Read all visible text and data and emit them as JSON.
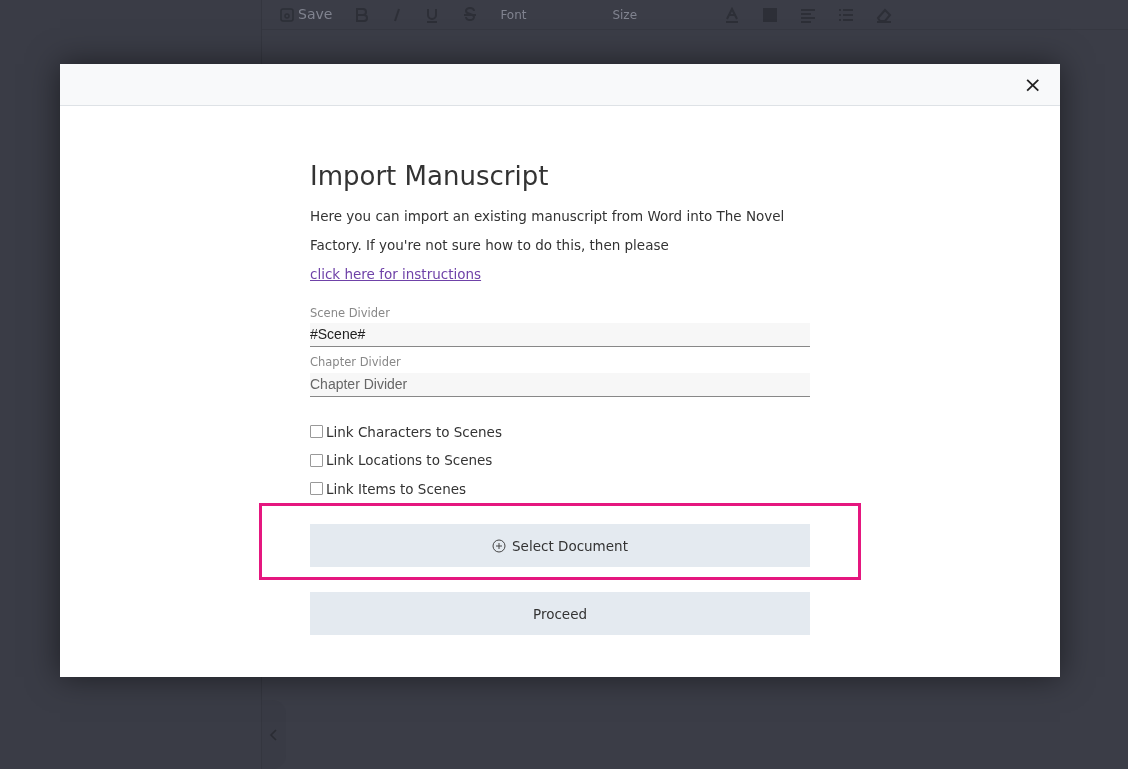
{
  "toolbar": {
    "save_label": "Save",
    "font_placeholder": "Font",
    "size_placeholder": "Size"
  },
  "dialog": {
    "close": "×",
    "title": "Import Manuscript",
    "intro": "Here you can import an existing manuscript from Word into The Novel Factory. If you're not sure how to do this, then please",
    "link": "click here for instructions",
    "fields": [
      {
        "label": "Scene Divider",
        "value": "#Scene#"
      },
      {
        "label": "Chapter Divider",
        "placeholder": "Chapter Divider"
      }
    ],
    "checkboxes": [
      {
        "label": "Link Characters to Scenes",
        "checked": false
      },
      {
        "label": "Link Locations to Scenes",
        "checked": false
      },
      {
        "label": "Link Items to Scenes",
        "checked": false
      }
    ],
    "buttons": [
      {
        "label": "Select Document",
        "kind": "add",
        "highlighted": true
      },
      {
        "label": "Proceed",
        "kind": "plain",
        "highlighted": false
      }
    ]
  }
}
